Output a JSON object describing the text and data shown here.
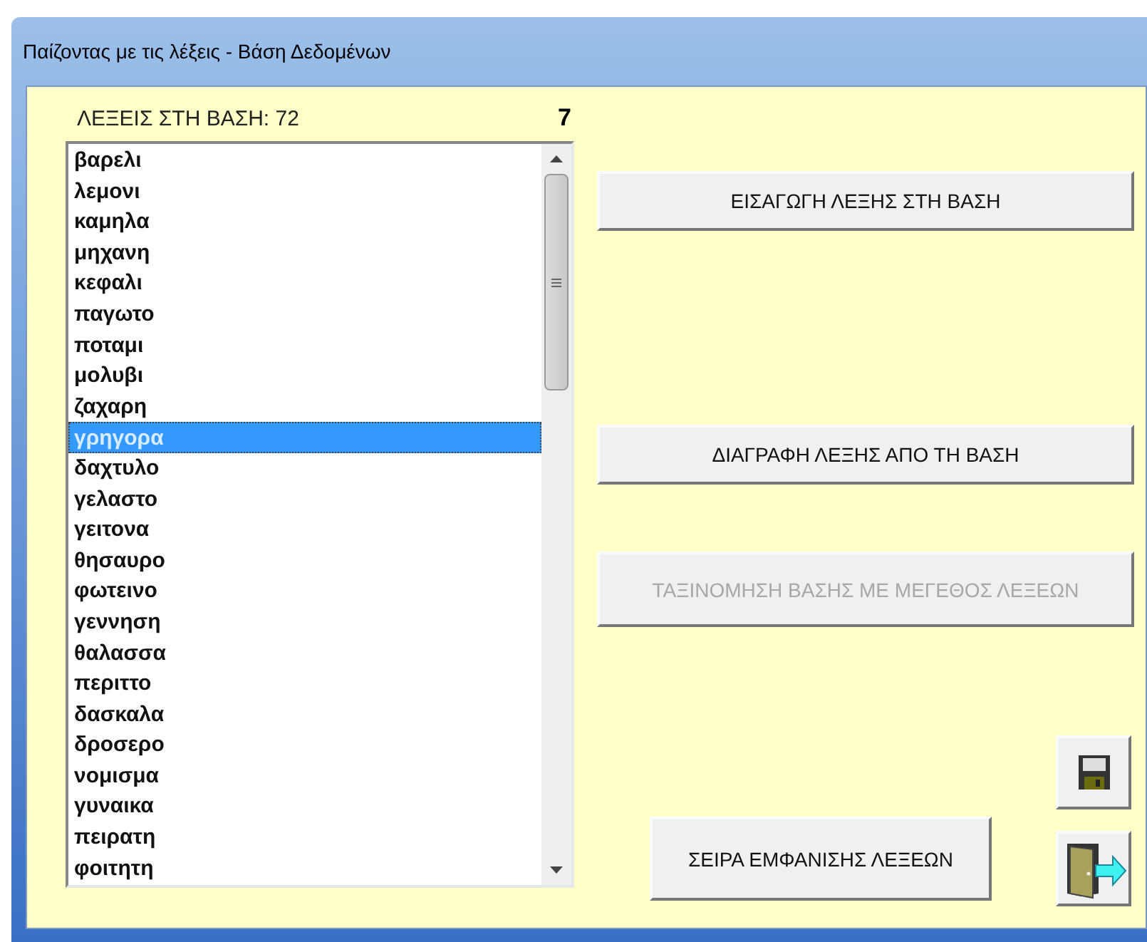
{
  "window": {
    "title": "Παίζοντας με τις λέξεις - Βάση Δεδομένων"
  },
  "count_label": "ΛΕΞΕΙΣ ΣΤΗ ΒΑΣΗ: 72",
  "counter": "7",
  "words": [
    {
      "text": "βαρελι",
      "selected": false
    },
    {
      "text": "λεμονι",
      "selected": false
    },
    {
      "text": "καμηλα",
      "selected": false
    },
    {
      "text": "μηχανη",
      "selected": false
    },
    {
      "text": "κεφαλι",
      "selected": false
    },
    {
      "text": "παγωτο",
      "selected": false
    },
    {
      "text": "ποταμι",
      "selected": false
    },
    {
      "text": "μολυβι",
      "selected": false
    },
    {
      "text": "ζαχαρη",
      "selected": false
    },
    {
      "text": "γρηγορα",
      "selected": true
    },
    {
      "text": "δαχτυλο",
      "selected": false
    },
    {
      "text": "γελαστο",
      "selected": false
    },
    {
      "text": "γειτονα",
      "selected": false
    },
    {
      "text": "θησαυρο",
      "selected": false
    },
    {
      "text": "φωτεινο",
      "selected": false
    },
    {
      "text": "γεννηση",
      "selected": false
    },
    {
      "text": "θαλασσα",
      "selected": false
    },
    {
      "text": "περιττο",
      "selected": false
    },
    {
      "text": "δασκαλα",
      "selected": false
    },
    {
      "text": "δροσερο",
      "selected": false
    },
    {
      "text": "νομισμα",
      "selected": false
    },
    {
      "text": "γυναικα",
      "selected": false
    },
    {
      "text": "πειρατη",
      "selected": false
    },
    {
      "text": "φοιτητη",
      "selected": false
    }
  ],
  "buttons": [
    {
      "label": "ΕΙΣΑΓΩΓΗ ΛΕΞΗΣ ΣΤΗ ΒΑΣΗ",
      "disabled": false
    },
    {
      "label": "ΔΙΑΓΡΑΦΗ ΛΕΞΗΣ ΑΠΟ ΤΗ ΒΑΣΗ",
      "disabled": false
    },
    {
      "label": "ΤΑΞΙΝΟΜΗΣΗ ΒΑΣΗΣ ΜΕ ΜΕΓΕΘΟΣ ΛΕΞΕΩΝ",
      "disabled": true
    },
    {
      "label": "ΣΕΙΡΑ ΕΜΦΑΝΙΣΗΣ ΛΕΞΕΩΝ",
      "disabled": false
    }
  ]
}
